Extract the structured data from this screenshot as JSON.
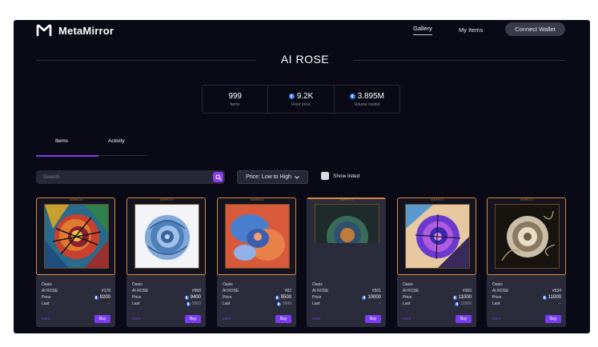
{
  "header": {
    "brand": "MetaMirror",
    "nav": {
      "gallery": "Gallery",
      "my_items": "My Items"
    },
    "connect_label": "Connect Wallet"
  },
  "collection": {
    "title": "AI ROSE",
    "stats": [
      {
        "value": "999",
        "label": "Items",
        "eth": false
      },
      {
        "value": "9.2K",
        "label": "Floor price",
        "eth": true
      },
      {
        "value": "3.895M",
        "label": "Volume traded",
        "eth": true
      }
    ]
  },
  "tabs": {
    "items": "Items",
    "activity": "Activity"
  },
  "toolbar": {
    "search_placeholder": "Search",
    "sort_label": "Price: Low to High",
    "show_listed_label": "Show listed"
  },
  "card_common": {
    "frame_tag": "MARKOV",
    "price_label": "Price",
    "last_label": "Last",
    "more_label": "more",
    "buy_label": "Buy"
  },
  "cards": [
    {
      "owner": "Oasis",
      "collection": "AI ROSE",
      "id": "#178",
      "price": "9200",
      "last": "--",
      "last_eth": false
    },
    {
      "owner": "Oasis",
      "collection": "AI ROSE",
      "id": "#968",
      "price": "9400",
      "last": "5500",
      "last_eth": true
    },
    {
      "owner": "Oasis",
      "collection": "AI ROSE",
      "id": "#82",
      "price": "9500",
      "last": "3999",
      "last_eth": true
    },
    {
      "owner": "Oasis",
      "collection": "AI ROSE",
      "id": "#501",
      "price": "10000",
      "last": "--",
      "last_eth": false
    },
    {
      "owner": "Oasis",
      "collection": "AI ROSE",
      "id": "#350",
      "price": "11000",
      "last": "11000",
      "last_eth": true
    },
    {
      "owner": "Oasis",
      "collection": "AI ROSE",
      "id": "#534",
      "price": "11000",
      "last": "--",
      "last_eth": false
    }
  ],
  "colors": {
    "background": "#0a0a17",
    "card": "#2b2c3b",
    "accent": "#7c3cf5",
    "frame": "#d58a3c",
    "eth": "#3f7df0"
  }
}
